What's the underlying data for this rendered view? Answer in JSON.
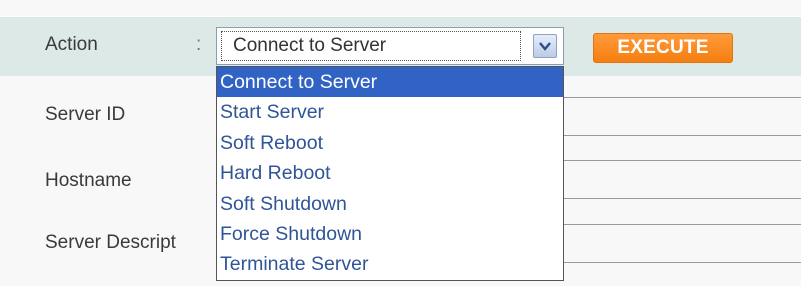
{
  "action": {
    "label": "Action",
    "colon": ":",
    "selected_value": "Connect to Server",
    "execute_label": "EXECUTE"
  },
  "fields": [
    {
      "label": "Server ID"
    },
    {
      "label": "Hostname"
    },
    {
      "label": "Server Descript"
    }
  ],
  "dropdown": {
    "options": [
      "Connect to Server",
      "Start Server",
      "Soft Reboot",
      "Hard Reboot",
      "Soft Shutdown",
      "Force Shutdown",
      "Terminate Server"
    ],
    "selected_index": 0
  },
  "colors": {
    "action_row_bg": "#dde9e6",
    "execute_button": "#f57f10",
    "selected_option_bg": "#3163c5",
    "option_text": "#2f5597"
  }
}
